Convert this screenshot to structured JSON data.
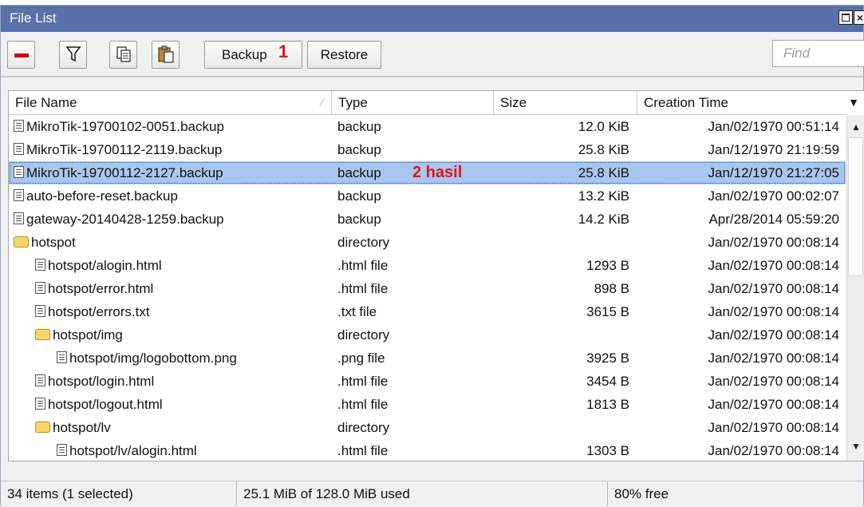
{
  "window": {
    "title": "File List"
  },
  "toolbar": {
    "remove_icon": "minus-icon",
    "filter_icon": "funnel-icon",
    "copy_icon": "copy-icon",
    "paste_icon": "paste-icon",
    "backup_label": "Backup",
    "backup_annotation": "1",
    "restore_label": "Restore",
    "find_placeholder": "Find"
  },
  "table": {
    "columns": [
      "File Name",
      "Type",
      "Size",
      "Creation Time"
    ],
    "annotation": "2 hasil",
    "rows": [
      {
        "name": "MikroTik-19700102-0051.backup",
        "type": "backup",
        "size": "12.0 KiB",
        "ctime": "Jan/02/1970 00:51:14",
        "icon": "file-icon",
        "indent": 0
      },
      {
        "name": "MikroTik-19700112-2119.backup",
        "type": "backup",
        "size": "25.8 KiB",
        "ctime": "Jan/12/1970 21:19:59",
        "icon": "file-icon",
        "indent": 0
      },
      {
        "name": "MikroTik-19700112-2127.backup",
        "type": "backup",
        "size": "25.8 KiB",
        "ctime": "Jan/12/1970 21:27:05",
        "icon": "file-icon",
        "indent": 0,
        "selected": true
      },
      {
        "name": "auto-before-reset.backup",
        "type": "backup",
        "size": "13.2 KiB",
        "ctime": "Jan/02/1970 00:02:07",
        "icon": "file-icon",
        "indent": 0
      },
      {
        "name": "gateway-20140428-1259.backup",
        "type": "backup",
        "size": "14.2 KiB",
        "ctime": "Apr/28/2014 05:59:20",
        "icon": "file-icon",
        "indent": 0
      },
      {
        "name": "hotspot",
        "type": "directory",
        "size": "",
        "ctime": "Jan/02/1970 00:08:14",
        "icon": "folder-icon",
        "indent": 0
      },
      {
        "name": "hotspot/alogin.html",
        "type": ".html file",
        "size": "1293 B",
        "ctime": "Jan/02/1970 00:08:14",
        "icon": "file-icon",
        "indent": 1
      },
      {
        "name": "hotspot/error.html",
        "type": ".html file",
        "size": "898 B",
        "ctime": "Jan/02/1970 00:08:14",
        "icon": "file-icon",
        "indent": 1
      },
      {
        "name": "hotspot/errors.txt",
        "type": ".txt file",
        "size": "3615 B",
        "ctime": "Jan/02/1970 00:08:14",
        "icon": "file-icon",
        "indent": 1
      },
      {
        "name": "hotspot/img",
        "type": "directory",
        "size": "",
        "ctime": "Jan/02/1970 00:08:14",
        "icon": "folder-icon",
        "indent": 1
      },
      {
        "name": "hotspot/img/logobottom.png",
        "type": ".png file",
        "size": "3925 B",
        "ctime": "Jan/02/1970 00:08:14",
        "icon": "file-icon",
        "indent": 2
      },
      {
        "name": "hotspot/login.html",
        "type": ".html file",
        "size": "3454 B",
        "ctime": "Jan/02/1970 00:08:14",
        "icon": "file-icon",
        "indent": 1
      },
      {
        "name": "hotspot/logout.html",
        "type": ".html file",
        "size": "1813 B",
        "ctime": "Jan/02/1970 00:08:14",
        "icon": "file-icon",
        "indent": 1
      },
      {
        "name": "hotspot/lv",
        "type": "directory",
        "size": "",
        "ctime": "Jan/02/1970 00:08:14",
        "icon": "folder-icon",
        "indent": 1
      },
      {
        "name": "hotspot/lv/alogin.html",
        "type": ".html file",
        "size": "1303 B",
        "ctime": "Jan/02/1970 00:08:14",
        "icon": "file-icon",
        "indent": 2
      }
    ]
  },
  "status": {
    "items": "34 items (1 selected)",
    "usage": "25.1 MiB of 128.0 MiB used",
    "free": "80% free"
  },
  "colors": {
    "titlebar": "#5a70a8",
    "selection": "#a9c6ee",
    "annotation": "#e3131a"
  }
}
